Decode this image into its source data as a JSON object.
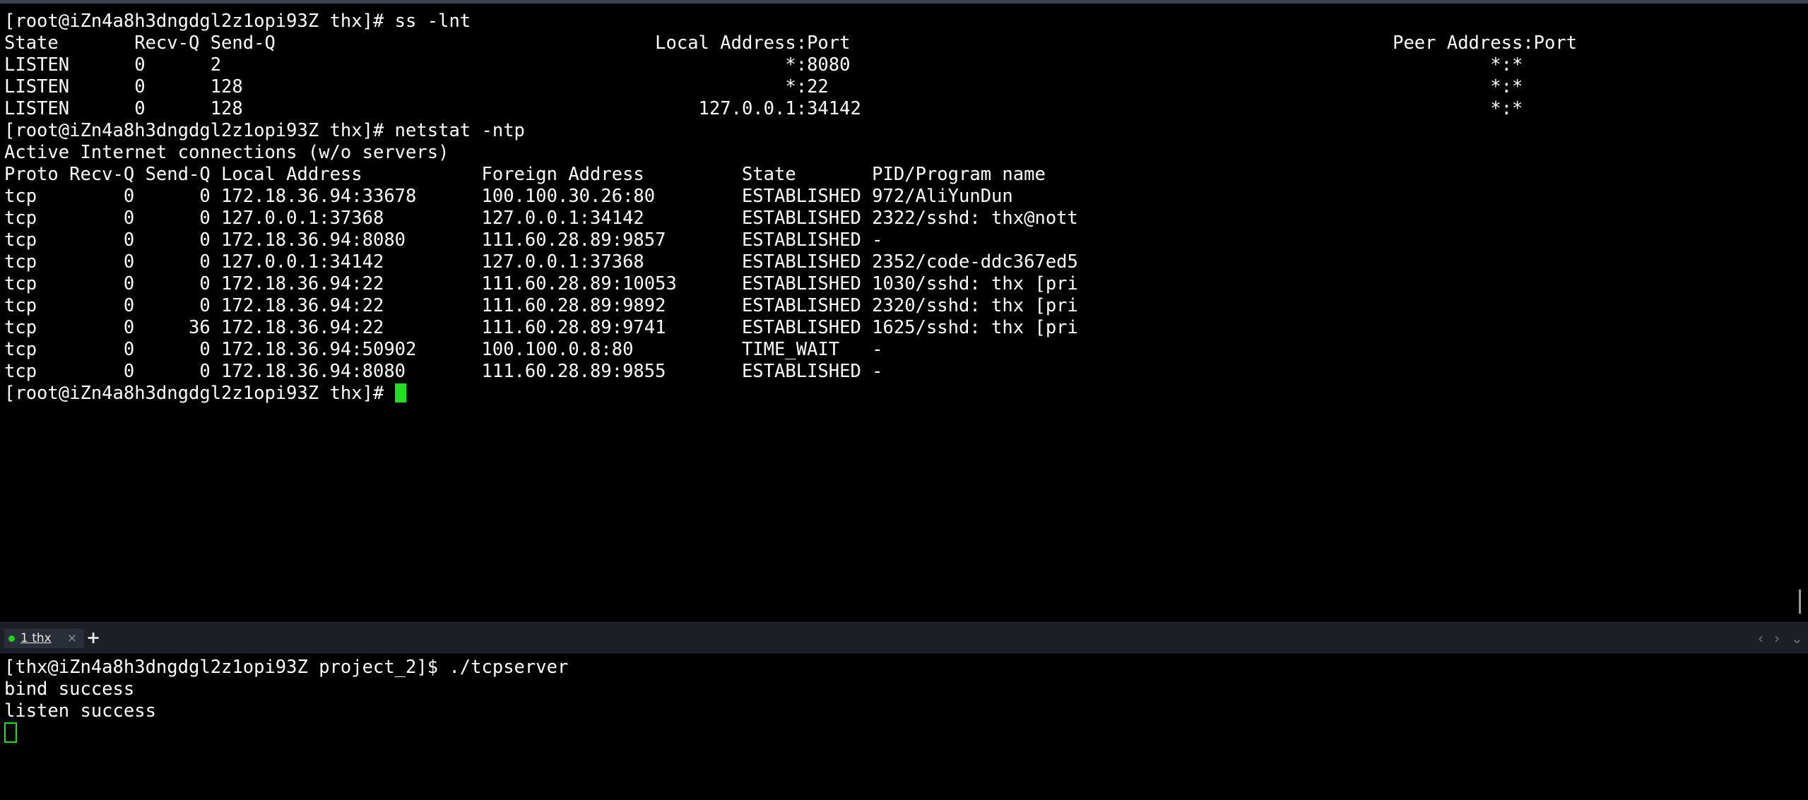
{
  "top_terminal": {
    "lines": [
      "[root@iZn4a8h3dngdgl2z1opi93Z thx]# ss -lnt",
      "State       Recv-Q Send-Q                                   Local Address:Port                                                  Peer Address:Port",
      "LISTEN      0      2                                                    *:8080                                                           *:*",
      "LISTEN      0      128                                                  *:22                                                             *:*",
      "LISTEN      0      128                                          127.0.0.1:34142                                                          *:*",
      "[root@iZn4a8h3dngdgl2z1opi93Z thx]# netstat -ntp",
      "Active Internet connections (w/o servers)",
      "Proto Recv-Q Send-Q Local Address           Foreign Address         State       PID/Program name",
      "tcp        0      0 172.18.36.94:33678      100.100.30.26:80        ESTABLISHED 972/AliYunDun",
      "tcp        0      0 127.0.0.1:37368         127.0.0.1:34142         ESTABLISHED 2322/sshd: thx@nott",
      "tcp        0      0 172.18.36.94:8080       111.60.28.89:9857       ESTABLISHED -",
      "tcp        0      0 127.0.0.1:34142         127.0.0.1:37368         ESTABLISHED 2352/code-ddc367ed5",
      "tcp        0      0 172.18.36.94:22         111.60.28.89:10053      ESTABLISHED 1030/sshd: thx [pri",
      "tcp        0      0 172.18.36.94:22         111.60.28.89:9892       ESTABLISHED 2320/sshd: thx [pri",
      "tcp        0     36 172.18.36.94:22         111.60.28.89:9741       ESTABLISHED 1625/sshd: thx [pri",
      "tcp        0      0 172.18.36.94:50902      100.100.0.8:80          TIME_WAIT   -",
      "tcp        0      0 172.18.36.94:8080       111.60.28.89:9855       ESTABLISHED -"
    ],
    "prompt": "[root@iZn4a8h3dngdgl2z1opi93Z thx]# "
  },
  "tab_bar": {
    "tab_label": "1 thx",
    "close_glyph": "×",
    "add_glyph": "+",
    "nav_left_glyph": "‹",
    "nav_right_glyph": "›",
    "menu_glyph": "⌄"
  },
  "bottom_terminal": {
    "lines": [
      "[thx@iZn4a8h3dngdgl2z1opi93Z project_2]$ ./tcpserver",
      "bind success",
      "listen success"
    ]
  },
  "colors": {
    "background": "#000000",
    "foreground": "#ffffff",
    "cursor": "#1fe01f",
    "tab_dot": "#1fd21f"
  }
}
